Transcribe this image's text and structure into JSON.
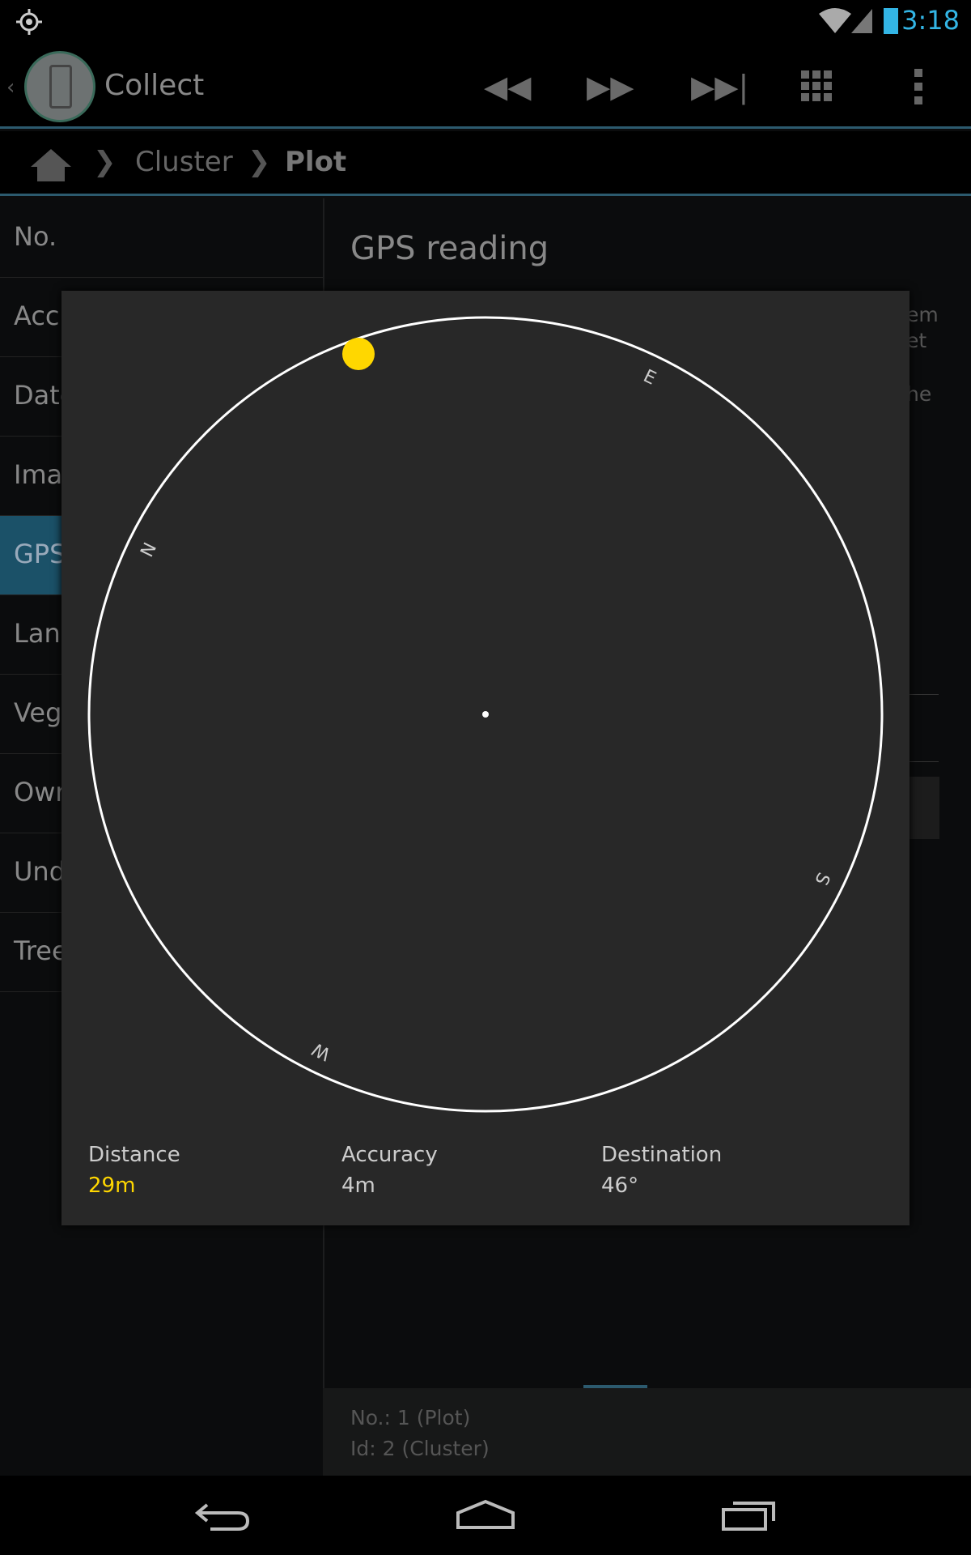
{
  "status_bar": {
    "time": "3:18",
    "icons": [
      "gps-icon",
      "wifi-icon",
      "signal-icon",
      "battery-icon"
    ]
  },
  "action_bar": {
    "title": "Collect",
    "actions": [
      "rewind-icon",
      "fast-forward-icon",
      "skip-to-end-icon",
      "grid-icon",
      "overflow-menu-icon"
    ]
  },
  "breadcrumb": {
    "items": [
      "Cluster",
      "Plot"
    ]
  },
  "sidebar": {
    "items": [
      {
        "label": "No."
      },
      {
        "label": "Acc"
      },
      {
        "label": "Date"
      },
      {
        "label": "Ima"
      },
      {
        "label": "GPS",
        "selected": true
      },
      {
        "label": "Lan"
      },
      {
        "label": "Veg"
      },
      {
        "label": "Owr"
      },
      {
        "label": "Und"
      },
      {
        "label": "Tree"
      }
    ]
  },
  "main": {
    "title": "GPS reading",
    "fragments": [
      "em",
      "et",
      "he"
    ]
  },
  "dialog": {
    "compass": {
      "labels": [
        "N",
        "E",
        "S",
        "W"
      ],
      "rotation_deg": -64,
      "target_color": "#ffd700"
    },
    "stats": [
      {
        "label": "Distance",
        "value": "29m",
        "color": "#ffd700"
      },
      {
        "label": "Accuracy",
        "value": "4m"
      },
      {
        "label": "Destination",
        "value": "46°"
      }
    ]
  },
  "footer": {
    "line1": "No.: 1 (Plot)",
    "line2": "Id: 2 (Cluster)"
  },
  "nav_bar": [
    "back-icon",
    "home-icon",
    "recent-apps-icon"
  ]
}
